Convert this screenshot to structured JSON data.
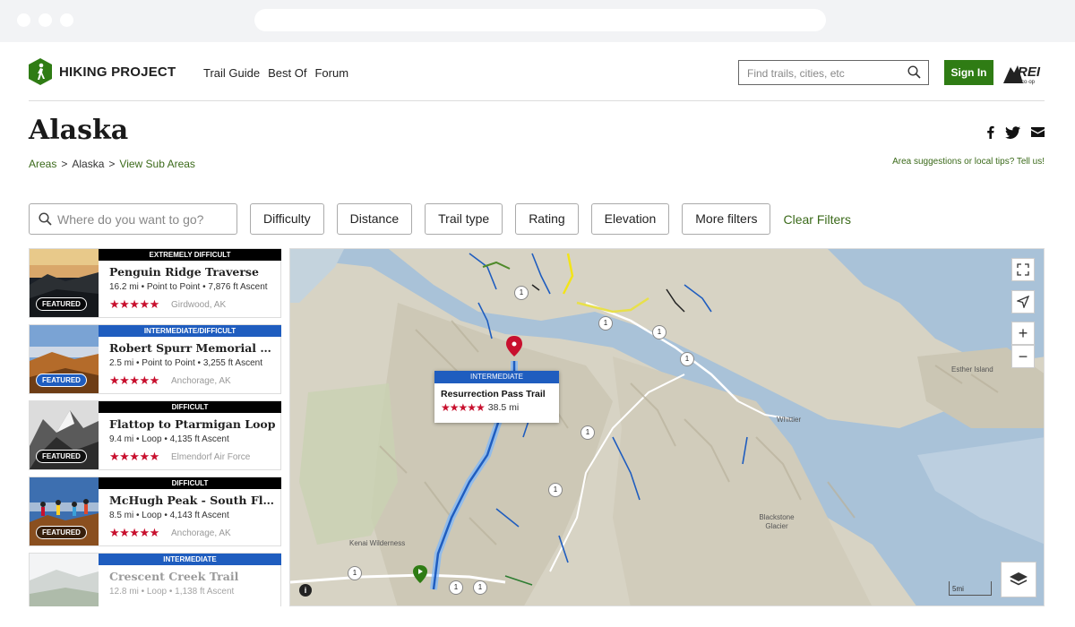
{
  "site": {
    "name": "HIKING PROJECT"
  },
  "nav": {
    "items": [
      "Trail Guide",
      "Best Of",
      "Forum"
    ]
  },
  "search": {
    "placeholder": "Find trails, cities, etc"
  },
  "signin": {
    "label": "Sign In"
  },
  "page": {
    "title": "Alaska",
    "tips": "Area suggestions or local tips? Tell us!"
  },
  "breadcrumb": {
    "areas": "Areas",
    "sep": ">",
    "current": "Alaska",
    "sub": "View Sub Areas"
  },
  "filters": {
    "where_placeholder": "Where do you want to go?",
    "buttons": [
      "Difficulty",
      "Distance",
      "Trail type",
      "Rating",
      "Elevation",
      "More filters"
    ],
    "clear": "Clear Filters"
  },
  "trails": [
    {
      "difficulty": "EXTREMELY DIFFICULT",
      "diff_color": "#000000",
      "name": "Penguin Ridge Traverse",
      "meta": "16.2 mi • Point to Point • 7,876 ft Ascent",
      "stars": "★★★★★",
      "location": "Girdwood, AK",
      "featured": "FEATURED"
    },
    {
      "difficulty": "INTERMEDIATE/DIFFICULT",
      "diff_color": "#1f5dbf",
      "name": "Robert Spurr Memorial Hill Trail",
      "meta": "2.5 mi • Point to Point • 3,255 ft Ascent",
      "stars": "★★★★★",
      "location": "Anchorage, AK",
      "featured": "FEATURED"
    },
    {
      "difficulty": "DIFFICULT",
      "diff_color": "#000000",
      "name": "Flattop to Ptarmigan Loop",
      "meta": "9.4 mi • Loop • 4,135 ft Ascent",
      "stars": "★★★★★",
      "location": "Elmendorf Air Force",
      "featured": "FEATURED"
    },
    {
      "difficulty": "DIFFICULT",
      "diff_color": "#000000",
      "name": "McHugh Peak - South Flank Loop",
      "meta": "8.5 mi • Loop • 4,143 ft Ascent",
      "stars": "★★★★★",
      "location": "Anchorage, AK",
      "featured": "FEATURED"
    },
    {
      "difficulty": "INTERMEDIATE",
      "diff_color": "#1f5dbf",
      "name": "Crescent Creek Trail",
      "meta": "12.8 mi • Loop • 1,138 ft Ascent",
      "stars": "",
      "location": "",
      "featured": ""
    }
  ],
  "map": {
    "popup": {
      "difficulty": "INTERMEDIATE",
      "name": "Resurrection Pass Trail",
      "stars": "★★★★★",
      "distance": "38.5 mi"
    },
    "labels": {
      "esther": "Esther Island",
      "whittier": "Whittier",
      "blackstone": "Blackstone Glacier",
      "kenai": "Kenai Wilderness"
    },
    "scale": "5mi",
    "info": "i",
    "zoom_in": "+",
    "zoom_out": "−",
    "markers": [
      "1",
      "1",
      "1",
      "1",
      "1",
      "1",
      "1",
      "1",
      "1"
    ]
  }
}
